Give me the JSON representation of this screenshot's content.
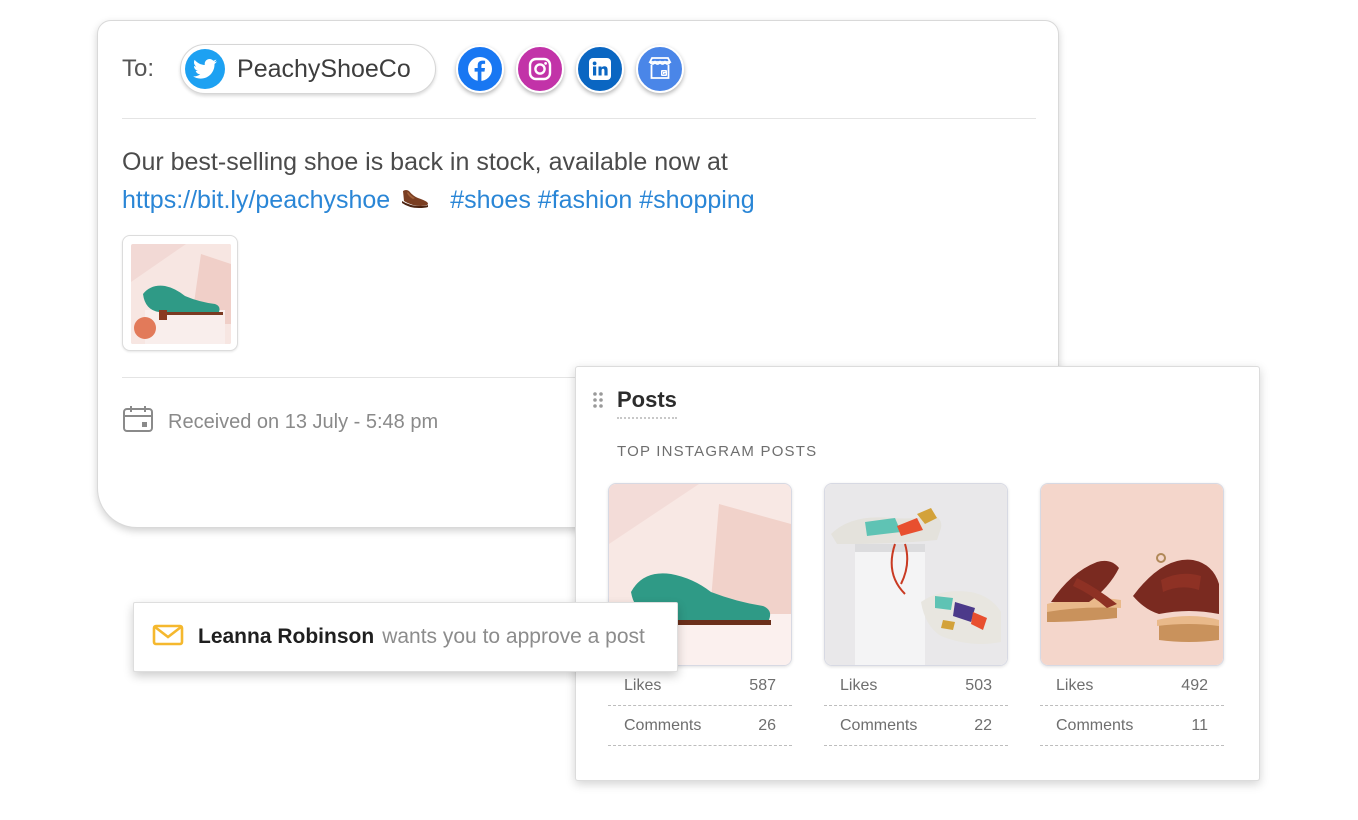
{
  "composer": {
    "to_label": "To:",
    "account_name": "PeachyShoeCo",
    "networks": [
      "facebook-icon",
      "instagram-icon",
      "linkedin-icon",
      "google-business-icon"
    ],
    "message_text": "Our best-selling shoe is back in stock, available now at",
    "message_link": "https://bit.ly/peachyshoe",
    "message_emoji": "shoe-icon",
    "message_hashtags": "#shoes #fashion #shopping",
    "received_text": "Received on 13 July - 5:48 pm"
  },
  "posts_panel": {
    "title": "Posts",
    "subtitle": "TOP INSTAGRAM POSTS",
    "posts": [
      {
        "likes_label": "Likes",
        "likes": "587",
        "comments_label": "Comments",
        "comments": "26"
      },
      {
        "likes_label": "Likes",
        "likes": "503",
        "comments_label": "Comments",
        "comments": "22"
      },
      {
        "likes_label": "Likes",
        "likes": "492",
        "comments_label": "Comments",
        "comments": "11"
      }
    ]
  },
  "notification": {
    "user": "Leanna Robinson",
    "action": "wants you to approve a post"
  },
  "colors": {
    "twitter": "#1da1f2",
    "facebook": "#1877f2",
    "instagram": "#c233a8",
    "linkedin": "#0a66c2",
    "google_business": "#4a86e8",
    "link": "#2a86d6",
    "mail_icon": "#f5b82e"
  }
}
